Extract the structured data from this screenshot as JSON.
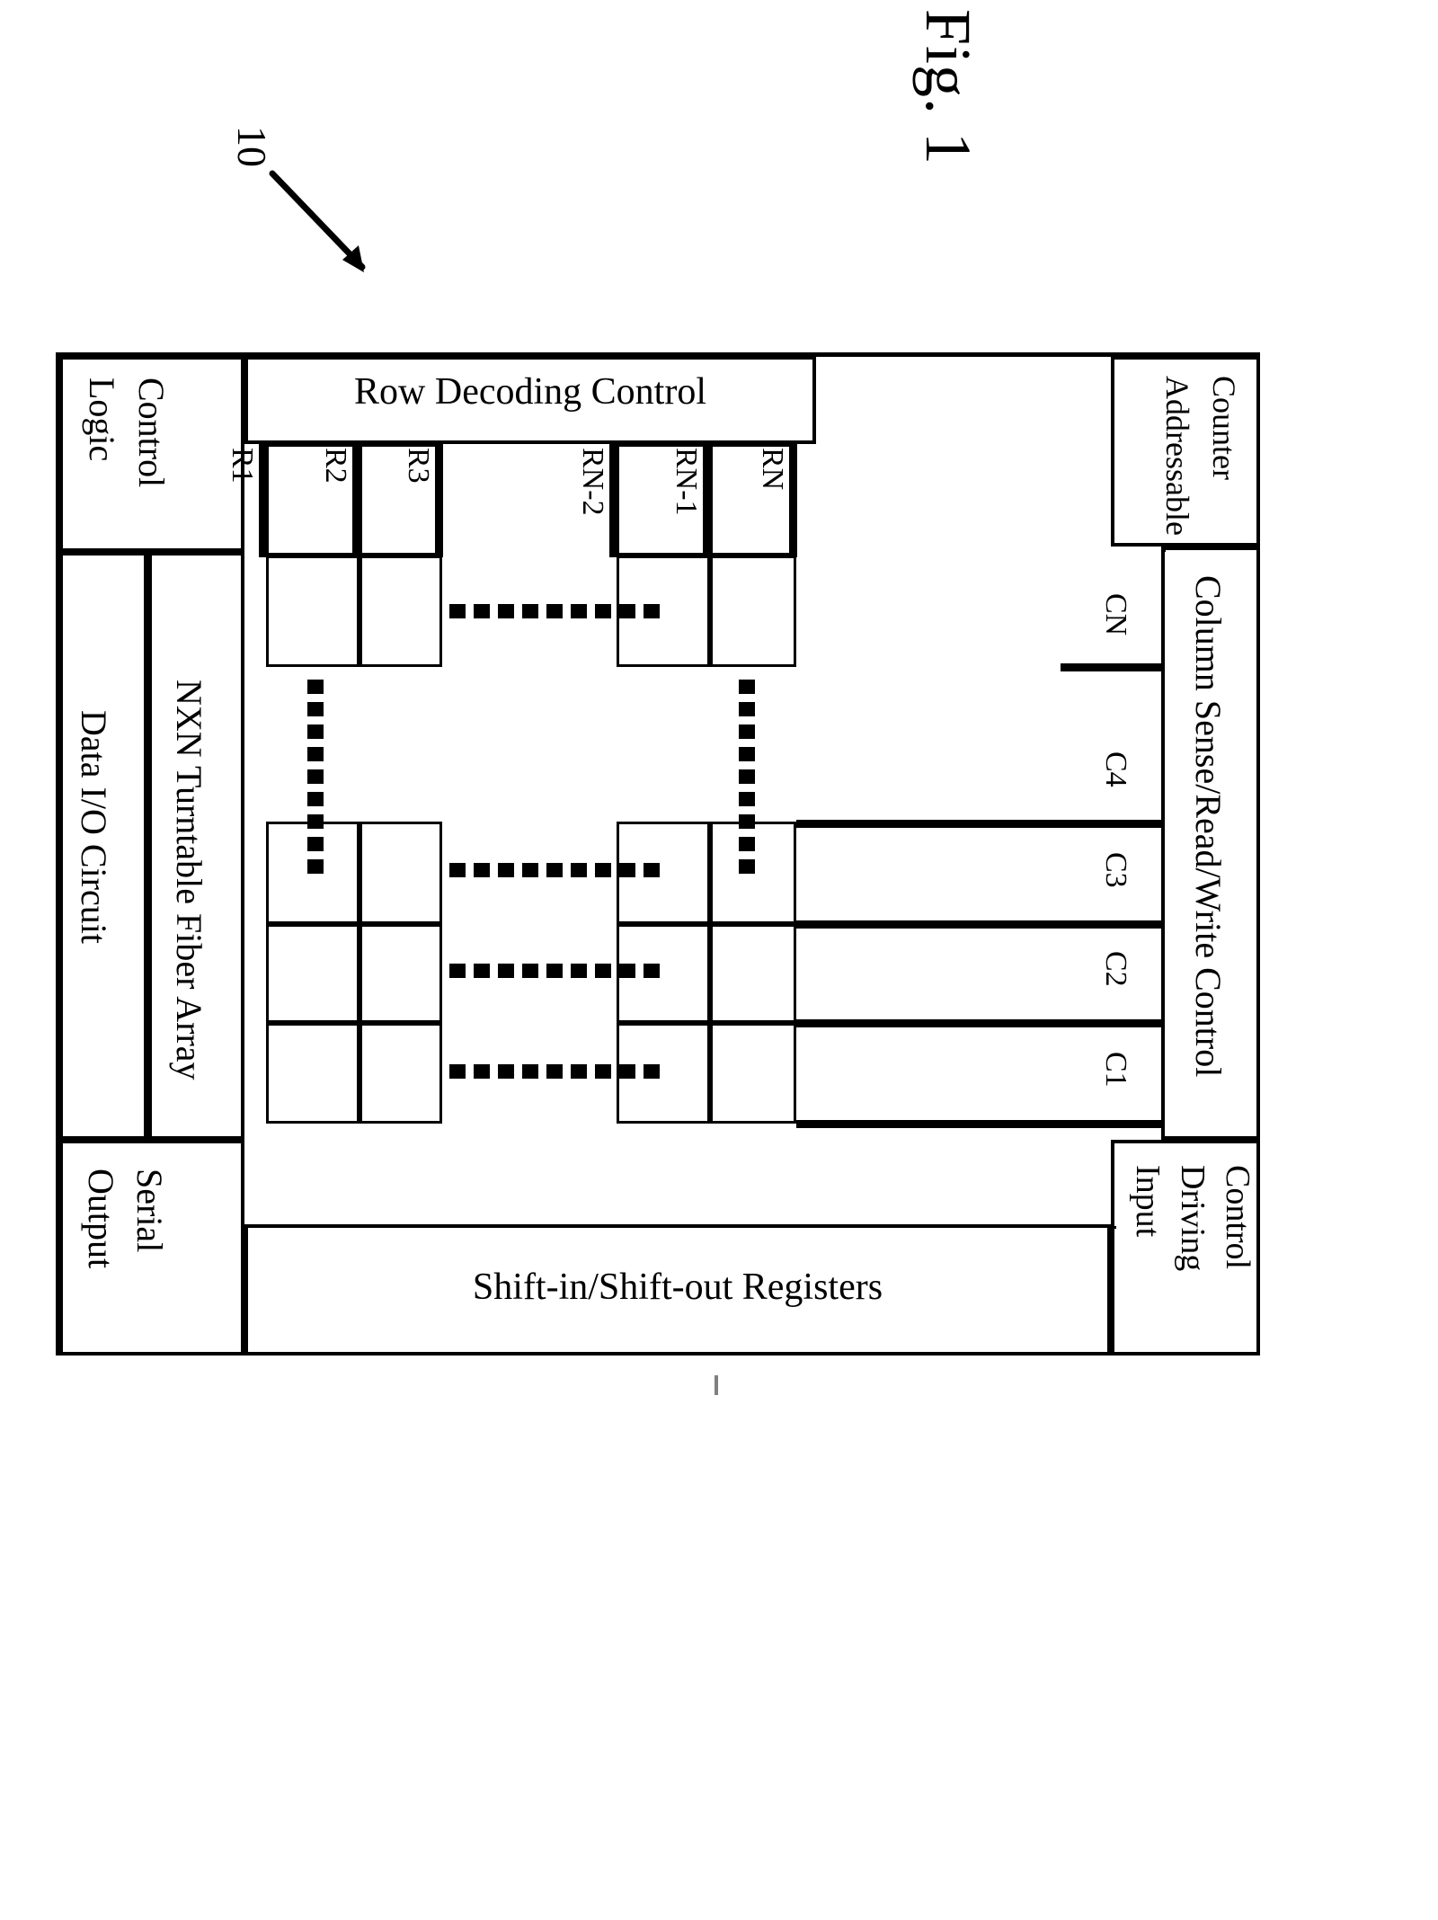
{
  "figure": {
    "title": "Fig. 1",
    "reference_numeral": "10"
  },
  "blocks": {
    "control_logic": "Control\nLogic",
    "control_logic_line1": "Control",
    "control_logic_line2": "Logic",
    "row_decoding_control": "Row Decoding Control",
    "addressable_counter_line1": "Addressable",
    "addressable_counter_line2": "Counter",
    "data_io_circuit": "Data I/O Circuit",
    "array_label": "NXN Turntable Fiber Array",
    "column_control": "Column Sense/Read/Write Control",
    "serial_output_line1": "Serial",
    "serial_output_line2": "Output",
    "shift_registers": "Shift-in/Shift-out Registers",
    "input_driving_line1": "Input",
    "input_driving_line2": "Driving",
    "input_driving_line3": "Control"
  },
  "row_labels": [
    "R1",
    "R2",
    "R3",
    "RN-2",
    "RN-1",
    "RN"
  ],
  "column_labels": [
    "C1",
    "C2",
    "C3",
    "C4",
    "CN"
  ],
  "ellipsis": {
    "glyph": "square-dot",
    "horizontal_counts": [
      9,
      9,
      9,
      9
    ],
    "vertical_counts": [
      9,
      9
    ]
  },
  "colors": {
    "stroke": "#000000",
    "background": "#ffffff"
  }
}
